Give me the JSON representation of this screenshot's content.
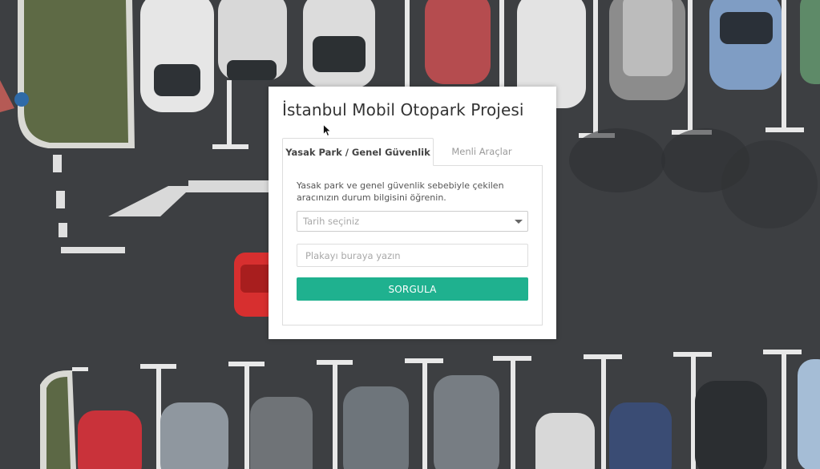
{
  "panel": {
    "title": "İstanbul Mobil Otopark Projesi",
    "tabs": [
      {
        "label": "Yasak Park / Genel Güvenlik",
        "active": true
      },
      {
        "label": "Menli Araçlar",
        "active": false
      }
    ],
    "description": "Yasak park ve genel güvenlik sebebiyle çekilen aracınızın durum bilgisini öğrenin.",
    "date_select": {
      "placeholder": "Tarih seçiniz"
    },
    "plate_input": {
      "placeholder": "Plakayı buraya yazın",
      "value": ""
    },
    "submit_label": "SORGULA"
  },
  "colors": {
    "accent": "#1fb18f",
    "asphalt": "#3b3d40"
  }
}
